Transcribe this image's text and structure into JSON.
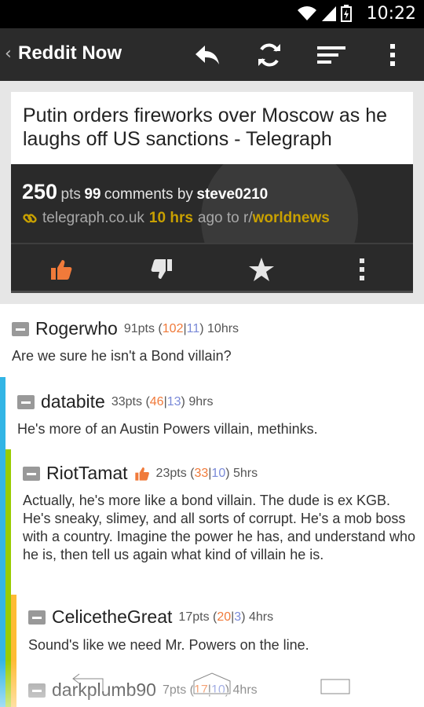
{
  "status": {
    "time": "10:22"
  },
  "actionbar": {
    "title": "Reddit Now"
  },
  "post": {
    "title": "Putin orders fireworks over Moscow as he laughs off US sanctions - Telegraph",
    "points": "250",
    "points_label": "pts",
    "comments": "99",
    "comments_label": "comments by",
    "author": "steve0210",
    "domain": "telegraph.co.uk",
    "age": "10 hrs",
    "age_label": "ago to r/",
    "subreddit": "worldnews"
  },
  "comments": [
    {
      "author": "Rogerwho",
      "points": "91pts",
      "up": "102",
      "down": "11",
      "age": "10hrs",
      "body": "Are we sure he isn't a Bond villain?"
    },
    {
      "author": "databite",
      "points": "33pts",
      "up": "46",
      "down": "13",
      "age": "9hrs",
      "body": "He's more of an Austin Powers villain, methinks."
    },
    {
      "author": "RiotTamat",
      "points": "23pts",
      "up": "33",
      "down": "10",
      "age": "5hrs",
      "body": "Actually,  he's more like a bond villain.  The dude is ex KGB. He's sneaky, slimey, and all sorts of corrupt. He's a mob boss with a country. Imagine the power he has, and understand who he is, then tell us again what kind of villain he is."
    },
    {
      "author": "CelicetheGreat",
      "points": "17pts",
      "up": "20",
      "down": "3",
      "age": "4hrs",
      "body": "Sound's like we need Mr. Powers on the line."
    },
    {
      "author": "darkplumb90",
      "points": "7pts",
      "up": "17",
      "down": "10",
      "age": "4hrs",
      "body": ""
    }
  ],
  "colors": {
    "depth1": "#33b5e5",
    "depth2": "#99cc00",
    "depth3": "#ffbb33",
    "upvote": "#f07a3a",
    "downvote": "#7a8ad8",
    "gold": "#c8a000"
  },
  "icons": [
    "back-chevron-icon",
    "reply-icon",
    "refresh-icon",
    "sort-icon",
    "overflow-menu-icon",
    "link-icon",
    "upvote-icon",
    "downvote-icon",
    "star-icon",
    "wifi-icon",
    "signal-icon",
    "battery-icon",
    "nav-back-icon",
    "nav-home-icon",
    "nav-recents-icon"
  ]
}
